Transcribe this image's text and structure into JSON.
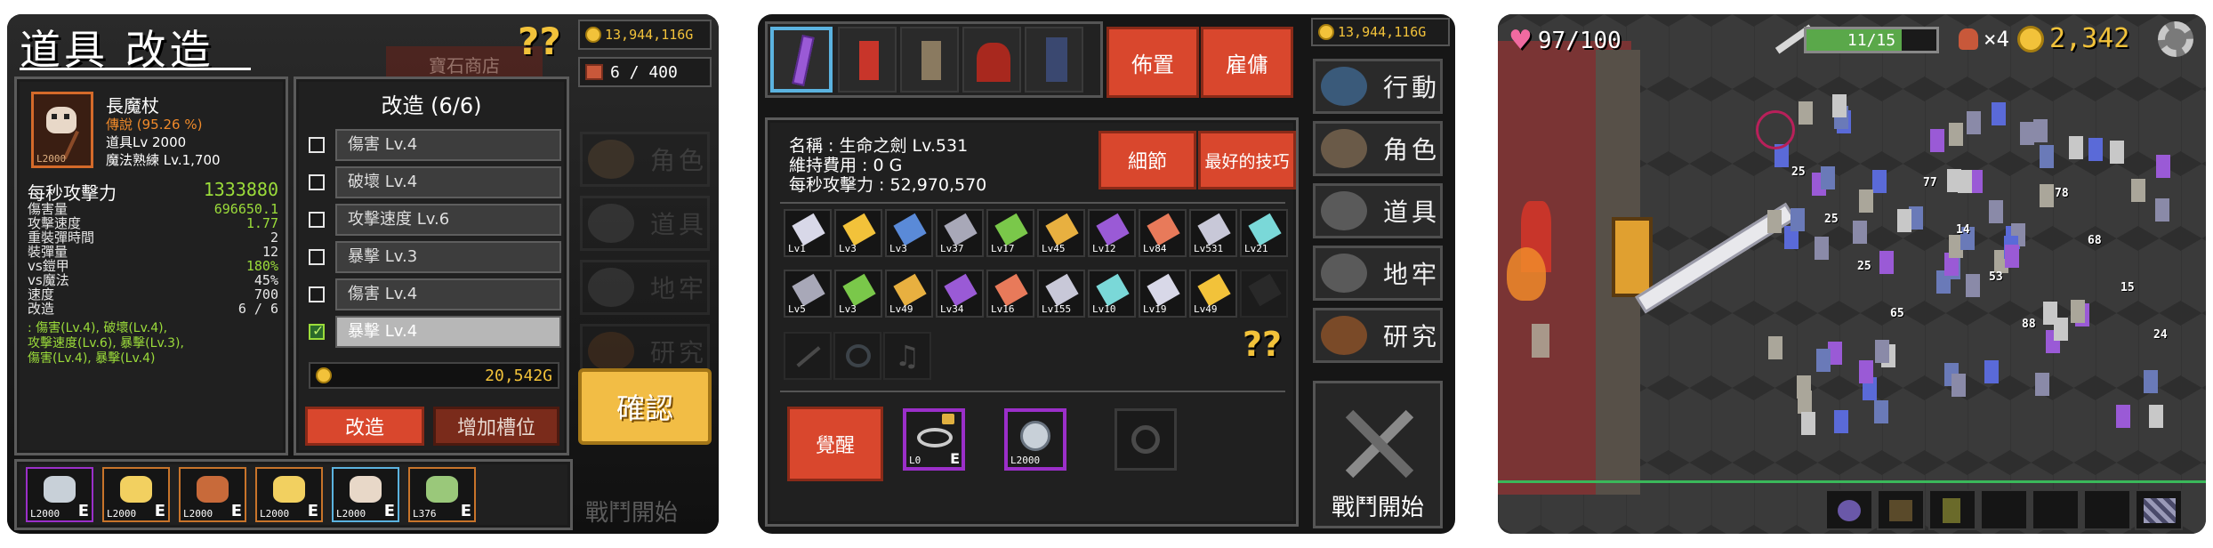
{
  "panel1": {
    "title": "道具 改造",
    "help_icon": "question-marks-icon",
    "gold": "13,944,116G",
    "inventory": "6 / 400",
    "shop_label": "寶石商店",
    "item": {
      "name": "長魔杖",
      "rarity": "傳說 (95.26 %)",
      "item_level": "道具Lv 2000",
      "skill": "魔法熟練 Lv.1,700",
      "portrait_level": "L2000"
    },
    "dps_label": "每秒攻擊力",
    "dps_value": "1333880",
    "stats": [
      {
        "label": "傷害量",
        "value": "696650.1"
      },
      {
        "label": "攻擊速度",
        "value": "1.77"
      },
      {
        "label": "重裝彈時間",
        "value": "2"
      },
      {
        "label": "裝彈量",
        "value": "12"
      },
      {
        "label": "vs鎧甲",
        "value": "180%"
      },
      {
        "label": "vs魔法",
        "value": "45%"
      },
      {
        "label": "速度",
        "value": "700"
      },
      {
        "label": "改造",
        "value": "6 / 6"
      }
    ],
    "mods_summary": [
      ": 傷害(Lv.4), 破壞(Lv.4),",
      "攻擊速度(Lv.6), 暴擊(Lv.3),",
      "傷害(Lv.4), 暴擊(Lv.4)"
    ],
    "upgrade_title": "改造 (6/6)",
    "upgrades": [
      {
        "label": "傷害 Lv.4",
        "checked": false
      },
      {
        "label": "破壞 Lv.4",
        "checked": false
      },
      {
        "label": "攻擊速度 Lv.6",
        "checked": false
      },
      {
        "label": "暴擊 Lv.3",
        "checked": false
      },
      {
        "label": "傷害 Lv.4",
        "checked": false
      },
      {
        "label": "暴擊 Lv.4",
        "checked": true
      }
    ],
    "cost": "20,542G",
    "btn_upgrade": "改造",
    "btn_add_slot": "增加槽位",
    "btn_confirm": "確認",
    "side_faded": [
      "角色",
      "道具",
      "地牢",
      "研究"
    ],
    "battle_start": "戰鬥開始",
    "slots": [
      {
        "level": "L2000",
        "icon": "axe-icon",
        "selected": false
      },
      {
        "level": "L2000",
        "icon": "star-wand-icon",
        "selected": false
      },
      {
        "level": "L2000",
        "icon": "scythe-icon",
        "selected": false
      },
      {
        "level": "L2000",
        "icon": "star-wand-icon",
        "selected": false
      },
      {
        "level": "L2000",
        "icon": "skull-staff-icon",
        "selected": true
      },
      {
        "level": "L376",
        "icon": "bow-icon",
        "selected": false
      }
    ]
  },
  "panel2": {
    "gold": "13,944,116G",
    "btn_deploy": "佈置",
    "btn_hire": "雇傭",
    "hero": {
      "name_line": "名稱 : 生命之劍 Lv.531",
      "upkeep_line": "維持費用 : 0 G",
      "dps_line": "每秒攻擊力 : 52,970,570"
    },
    "btn_detail": "細節",
    "btn_best_skill": "最好的技巧",
    "skills_row1": [
      "Lv1",
      "Lv3",
      "Lv3",
      "Lv37",
      "Lv17",
      "Lv45",
      "Lv12",
      "Lv84",
      "Lv531",
      "Lv21"
    ],
    "skills_row2": [
      "Lv5",
      "Lv3",
      "Lv49",
      "Lv34",
      "Lv16",
      "Lv155",
      "Lv10",
      "Lv19",
      "Lv49",
      ""
    ],
    "btn_awaken": "覺醒",
    "relic_level_1": "L0",
    "relic_level_2": "L2000",
    "side": [
      "行動",
      "角色",
      "道具",
      "地牢",
      "研究"
    ],
    "battle_start": "戰鬥開始"
  },
  "panel3": {
    "hp": "97/100",
    "wave": "11/15",
    "potions": "×4",
    "gold": "2,342",
    "damage_numbers": [
      "25",
      "25",
      "25",
      "65",
      "77",
      "14",
      "53",
      "88",
      "78",
      "68",
      "15",
      "24"
    ]
  },
  "colors": {
    "accent_red": "#d9472d",
    "gold_text": "#f2c23a",
    "green_text": "#9bdc3a",
    "selected_slot": "#9b2fc9"
  }
}
